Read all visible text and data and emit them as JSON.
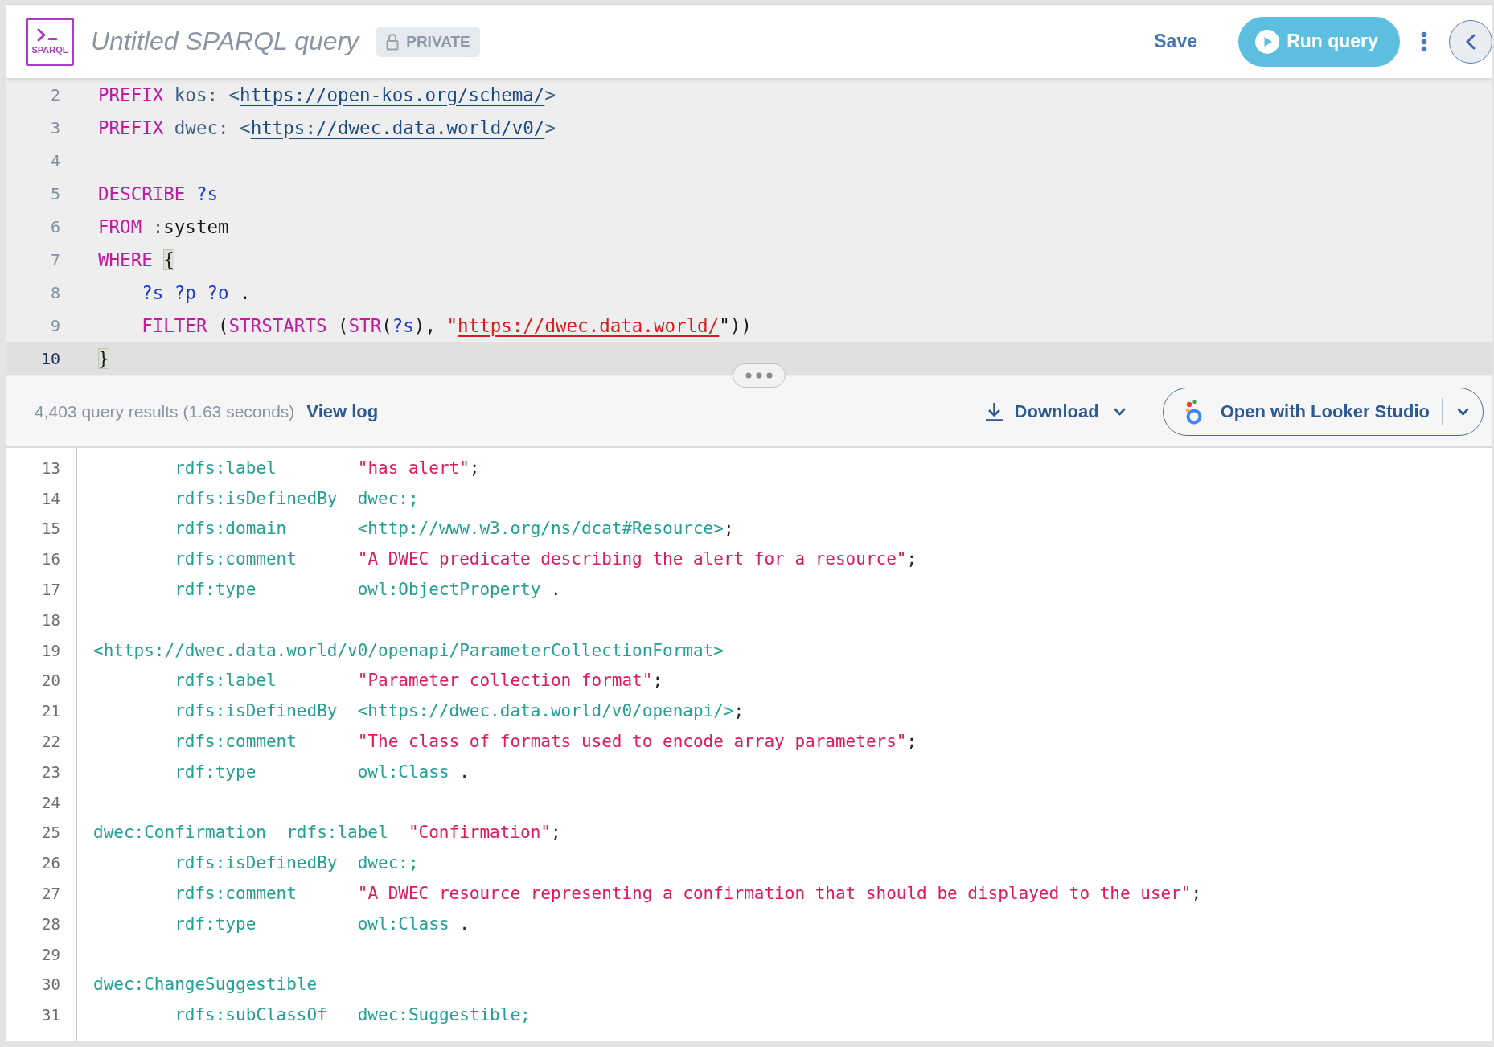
{
  "header": {
    "logo_text": "SPARQL",
    "title": "Untitled SPARQL query",
    "visibility": "PRIVATE",
    "save": "Save",
    "run": "Run query"
  },
  "editor": {
    "lines": [
      {
        "number": "2",
        "active": false,
        "tokens": [
          {
            "kind": "keyword",
            "text": "PREFIX"
          },
          {
            "kind": "prefix",
            "text": " kos: <"
          },
          {
            "kind": "link",
            "text": "https://open-kos.org/schema/"
          },
          {
            "kind": "prefix",
            "text": ">"
          }
        ]
      },
      {
        "number": "3",
        "active": false,
        "tokens": [
          {
            "kind": "keyword",
            "text": "PREFIX"
          },
          {
            "kind": "prefix",
            "text": " dwec: <"
          },
          {
            "kind": "link",
            "text": "https://dwec.data.world/v0/"
          },
          {
            "kind": "prefix",
            "text": ">"
          }
        ]
      },
      {
        "number": "4",
        "active": false
      },
      {
        "number": "5",
        "active": false,
        "tokens": [
          {
            "kind": "keyword",
            "text": "DESCRIBE"
          },
          {
            "kind": "variable",
            "text": " ?s"
          }
        ]
      },
      {
        "number": "6",
        "active": false,
        "tokens": [
          {
            "kind": "keyword",
            "text": "FROM"
          },
          {
            "kind": "prefix",
            "text": " :"
          },
          {
            "kind": "plain",
            "text": "system"
          }
        ]
      },
      {
        "number": "7",
        "active": false,
        "tokens": [
          {
            "kind": "keyword",
            "text": "WHERE "
          },
          {
            "kind": "bracket",
            "text": "{"
          }
        ]
      },
      {
        "number": "8",
        "active": false,
        "tokens": [
          {
            "kind": "variable",
            "text": "    ?s ?p ?o"
          },
          {
            "kind": "plain",
            "text": " ."
          }
        ]
      },
      {
        "number": "9",
        "active": false,
        "tokens": [
          {
            "kind": "keyword",
            "text": "    FILTER"
          },
          {
            "kind": "plain",
            "text": " ("
          },
          {
            "kind": "keyword",
            "text": "STRSTARTS"
          },
          {
            "kind": "plain",
            "text": " ("
          },
          {
            "kind": "keyword",
            "text": "STR"
          },
          {
            "kind": "plain",
            "text": "("
          },
          {
            "kind": "variable",
            "text": "?s"
          },
          {
            "kind": "plain",
            "text": "), "
          },
          {
            "kind": "string",
            "text": "\""
          },
          {
            "kind": "string_link",
            "text": "https://dwec.data.world/"
          },
          {
            "kind": "plain",
            "text": "\"))"
          }
        ]
      },
      {
        "number": "10",
        "active": true,
        "tokens": [
          {
            "kind": "bracket",
            "text": "}"
          }
        ]
      }
    ]
  },
  "results_bar": {
    "summary": "4,403 query results (1.63 seconds)",
    "view_log": "View log",
    "download": "Download",
    "looker": "Open with Looker Studio"
  },
  "results": {
    "lines": [
      {
        "number": "13",
        "tokens": [
          {
            "kind": "term",
            "text": "        rdfs:label        "
          },
          {
            "kind": "string",
            "text": "\"has alert\""
          },
          {
            "kind": "plain",
            "text": ";"
          }
        ]
      },
      {
        "number": "14",
        "tokens": [
          {
            "kind": "term",
            "text": "        rdfs:isDefinedBy  dwec:;"
          }
        ]
      },
      {
        "number": "15",
        "tokens": [
          {
            "kind": "term",
            "text": "        rdfs:domain       <http://www.w3.org/ns/dcat#Resource>"
          },
          {
            "kind": "plain",
            "text": ";"
          }
        ]
      },
      {
        "number": "16",
        "tokens": [
          {
            "kind": "term",
            "text": "        rdfs:comment      "
          },
          {
            "kind": "string",
            "text": "\"A DWEC predicate describing the alert for a resource\""
          },
          {
            "kind": "plain",
            "text": ";"
          }
        ]
      },
      {
        "number": "17",
        "tokens": [
          {
            "kind": "term",
            "text": "        rdf:type          owl:ObjectProperty"
          },
          {
            "kind": "plain",
            "text": " ."
          }
        ]
      },
      {
        "number": "18"
      },
      {
        "number": "19",
        "tokens": [
          {
            "kind": "term",
            "text": "<https://dwec.data.world/v0/openapi/ParameterCollectionFormat>"
          }
        ]
      },
      {
        "number": "20",
        "tokens": [
          {
            "kind": "term",
            "text": "        rdfs:label        "
          },
          {
            "kind": "string",
            "text": "\"Parameter collection format\""
          },
          {
            "kind": "plain",
            "text": ";"
          }
        ]
      },
      {
        "number": "21",
        "tokens": [
          {
            "kind": "term",
            "text": "        rdfs:isDefinedBy  <https://dwec.data.world/v0/openapi/>"
          },
          {
            "kind": "plain",
            "text": ";"
          }
        ]
      },
      {
        "number": "22",
        "tokens": [
          {
            "kind": "term",
            "text": "        rdfs:comment      "
          },
          {
            "kind": "string",
            "text": "\"The class of formats used to encode array parameters\""
          },
          {
            "kind": "plain",
            "text": ";"
          }
        ]
      },
      {
        "number": "23",
        "tokens": [
          {
            "kind": "term",
            "text": "        rdf:type          owl:Class"
          },
          {
            "kind": "plain",
            "text": " ."
          }
        ]
      },
      {
        "number": "24"
      },
      {
        "number": "25",
        "tokens": [
          {
            "kind": "term",
            "text": "dwec:Confirmation  rdfs:label  "
          },
          {
            "kind": "string",
            "text": "\"Confirmation\""
          },
          {
            "kind": "plain",
            "text": ";"
          }
        ]
      },
      {
        "number": "26",
        "tokens": [
          {
            "kind": "term",
            "text": "        rdfs:isDefinedBy  dwec:;"
          }
        ]
      },
      {
        "number": "27",
        "tokens": [
          {
            "kind": "term",
            "text": "        rdfs:comment      "
          },
          {
            "kind": "string",
            "text": "\"A DWEC resource representing a confirmation that should be displayed to the user\""
          },
          {
            "kind": "plain",
            "text": ";"
          }
        ]
      },
      {
        "number": "28",
        "tokens": [
          {
            "kind": "term",
            "text": "        rdf:type          owl:Class"
          },
          {
            "kind": "plain",
            "text": " ."
          }
        ]
      },
      {
        "number": "29"
      },
      {
        "number": "30",
        "tokens": [
          {
            "kind": "term",
            "text": "dwec:ChangeSuggestible"
          }
        ]
      },
      {
        "number": "31",
        "tokens": [
          {
            "kind": "term",
            "text": "        rdfs:subClassOf   dwec:Suggestible;"
          }
        ]
      }
    ]
  }
}
